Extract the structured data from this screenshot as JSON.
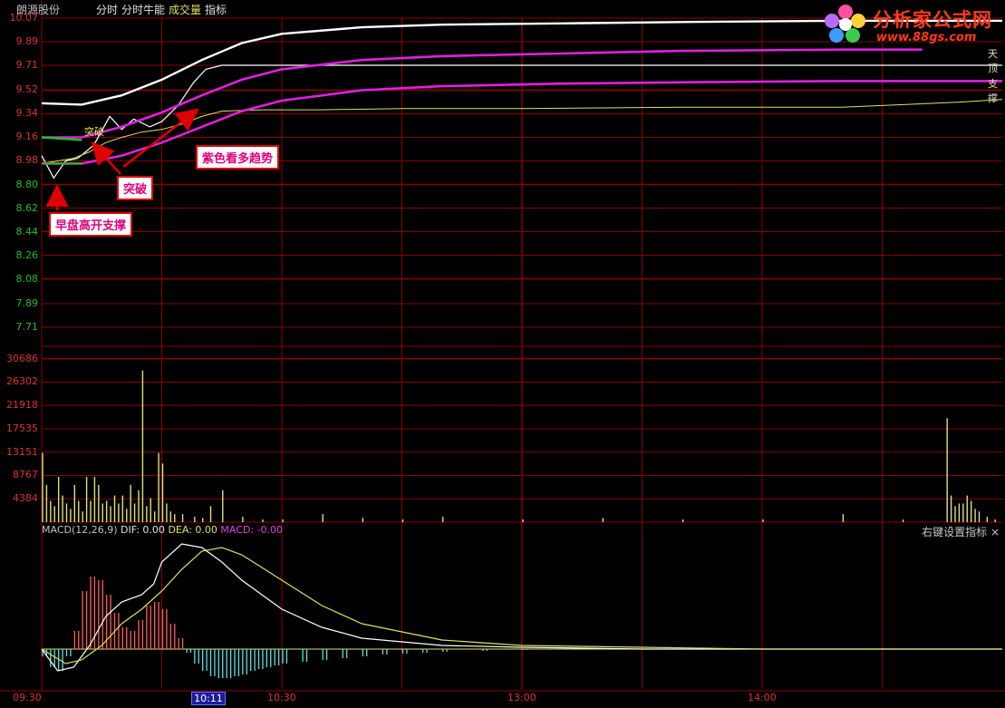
{
  "header": {
    "stock_name": "朗源股份",
    "tabs": [
      "分时",
      "分时牛能",
      "成交量",
      "指标"
    ]
  },
  "logo": {
    "title": "分析家公式网",
    "url": "www.88gs.com"
  },
  "annotations": {
    "support": "早盘高开支撑",
    "breakout": "突破",
    "trend": "紫色看多趋势",
    "inline_breakout": "突破"
  },
  "edge_labels": {
    "upper": "天顶",
    "support": "支撑"
  },
  "macd": {
    "label": "MACD(12,26,9)",
    "dif": "DIF: 0.00",
    "dea": "DEA: 0.00",
    "macd": "MACD: -0.00",
    "right_link": "右键设置指标 ×"
  },
  "colors": {
    "background": "#000000",
    "grid": "#8b0000",
    "axis_text": "#e03030",
    "price_line": "#ffffff",
    "avg_line": "#e0e060",
    "trend_line": "#e020e0",
    "support_line": "#20c020",
    "vol_bar": "#e0e080",
    "macd_pos": "#ff6060",
    "macd_neg": "#60e0e0"
  },
  "chart_data": {
    "type": "line",
    "price_axis": {
      "ticks": [
        "10.07",
        "9.89",
        "9.71",
        "9.52",
        "9.34",
        "9.16",
        "8.98",
        "8.80",
        "8.62",
        "8.44",
        "8.26",
        "8.08",
        "7.89",
        "7.71"
      ],
      "ylim": [
        7.62,
        10.07
      ]
    },
    "time_axis": {
      "ticks": [
        "09:30",
        "10:11",
        "10:30",
        "13:00",
        "14:00"
      ],
      "selected": "10:11"
    },
    "volume_axis": {
      "ticks": [
        "30686",
        "26302",
        "21918",
        "17535",
        "13151",
        "8767",
        "4384"
      ],
      "ylim": [
        0,
        32000
      ]
    },
    "series": [
      {
        "name": "price",
        "x": [
          0,
          3,
          6,
          9,
          13,
          17,
          20,
          23,
          27,
          30,
          34,
          38,
          41,
          45,
          50,
          56,
          65,
          75,
          90,
          110,
          240
        ],
        "y": [
          9.02,
          8.85,
          8.98,
          9.0,
          9.1,
          9.32,
          9.22,
          9.3,
          9.24,
          9.28,
          9.4,
          9.58,
          9.68,
          9.71,
          9.71,
          9.71,
          9.71,
          9.71,
          9.71,
          9.71,
          9.71
        ]
      },
      {
        "name": "avg",
        "x": [
          0,
          4,
          8,
          12,
          16,
          20,
          25,
          30,
          35,
          40,
          45,
          55,
          70,
          90,
          120,
          160,
          200,
          230,
          240
        ],
        "y": [
          8.96,
          8.98,
          9.0,
          9.05,
          9.12,
          9.16,
          9.2,
          9.22,
          9.26,
          9.32,
          9.36,
          9.37,
          9.37,
          9.38,
          9.38,
          9.39,
          9.39,
          9.43,
          9.45
        ]
      },
      {
        "name": "upper_trend",
        "x": [
          0,
          10,
          20,
          30,
          40,
          50,
          60,
          80,
          100,
          130,
          160,
          200,
          240
        ],
        "y": [
          9.42,
          9.41,
          9.48,
          9.6,
          9.75,
          9.88,
          9.95,
          10.0,
          10.02,
          10.03,
          10.04,
          10.05,
          10.05
        ]
      },
      {
        "name": "purple_upper",
        "x": [
          0,
          10,
          20,
          30,
          40,
          50,
          60,
          80,
          100,
          130,
          160,
          200,
          220
        ],
        "y": [
          9.16,
          9.16,
          9.24,
          9.35,
          9.48,
          9.6,
          9.68,
          9.75,
          9.78,
          9.8,
          9.82,
          9.83,
          9.83
        ]
      },
      {
        "name": "purple_lower",
        "x": [
          0,
          10,
          20,
          30,
          40,
          50,
          60,
          80,
          100,
          130,
          160,
          200,
          240
        ],
        "y": [
          8.96,
          8.96,
          9.02,
          9.12,
          9.24,
          9.36,
          9.44,
          9.52,
          9.55,
          9.57,
          9.58,
          9.59,
          9.59
        ]
      },
      {
        "name": "support",
        "x": [
          0,
          10
        ],
        "y": [
          9.16,
          9.14
        ]
      },
      {
        "name": "support_lower",
        "x": [
          0,
          10
        ],
        "y": [
          8.96,
          8.96
        ]
      }
    ],
    "volume": {
      "x": [
        0,
        1,
        2,
        3,
        4,
        5,
        6,
        7,
        8,
        9,
        10,
        11,
        12,
        13,
        14,
        15,
        16,
        17,
        18,
        19,
        20,
        21,
        22,
        23,
        24,
        25,
        26,
        27,
        28,
        29,
        30,
        31,
        32,
        33,
        35,
        38,
        40,
        42,
        45,
        50,
        55,
        60,
        70,
        80,
        90,
        100,
        120,
        140,
        160,
        180,
        200,
        215,
        226,
        227,
        228,
        229,
        230,
        231,
        232,
        233,
        234,
        236,
        238
      ],
      "y": [
        13000,
        7000,
        4000,
        3000,
        8500,
        5000,
        3500,
        2500,
        7000,
        4000,
        2000,
        8500,
        4000,
        8500,
        7000,
        3500,
        4000,
        3000,
        5000,
        3500,
        5000,
        2500,
        7000,
        3500,
        6000,
        28500,
        3000,
        4500,
        2000,
        13000,
        11000,
        3500,
        2000,
        1500,
        1500,
        1000,
        800,
        3000,
        6000,
        1000,
        500,
        500,
        1500,
        800,
        500,
        1000,
        500,
        800,
        500,
        500,
        1500,
        500,
        19500,
        5000,
        3000,
        3500,
        3500,
        5000,
        4000,
        2500,
        2000,
        1000,
        500
      ]
    },
    "macd_series": {
      "dif_x": [
        0,
        4,
        8,
        12,
        16,
        20,
        25,
        28,
        30,
        35,
        40,
        45,
        50,
        60,
        70,
        80,
        100,
        120,
        150,
        180,
        240
      ],
      "dif_y": [
        0,
        -0.12,
        -0.1,
        0.02,
        0.18,
        0.26,
        0.3,
        0.36,
        0.48,
        0.58,
        0.56,
        0.48,
        0.38,
        0.22,
        0.12,
        0.06,
        0.02,
        0.01,
        0.0,
        0.0,
        0.0
      ],
      "dea_x": [
        0,
        6,
        10,
        15,
        20,
        25,
        30,
        35,
        40,
        45,
        50,
        60,
        70,
        80,
        100,
        120,
        150,
        180,
        240
      ],
      "dea_y": [
        0,
        -0.08,
        -0.06,
        0.02,
        0.14,
        0.22,
        0.32,
        0.44,
        0.54,
        0.56,
        0.52,
        0.38,
        0.24,
        0.14,
        0.05,
        0.02,
        0.01,
        0.0,
        0.0
      ],
      "hist_x": [
        0,
        2,
        4,
        6,
        8,
        10,
        12,
        14,
        16,
        18,
        20,
        22,
        24,
        26,
        28,
        30,
        32,
        34,
        36,
        38,
        40,
        42,
        44,
        46,
        48,
        50,
        52,
        54,
        56,
        58,
        60,
        65,
        70,
        75,
        80,
        85,
        90,
        95,
        100,
        110,
        120,
        130,
        140
      ],
      "hist_y": [
        -0.04,
        -0.1,
        -0.12,
        -0.04,
        0.1,
        0.32,
        0.4,
        0.38,
        0.3,
        0.2,
        0.12,
        0.1,
        0.16,
        0.24,
        0.26,
        0.22,
        0.14,
        0.06,
        -0.02,
        -0.08,
        -0.12,
        -0.15,
        -0.16,
        -0.16,
        -0.15,
        -0.14,
        -0.12,
        -0.11,
        -0.1,
        -0.09,
        -0.08,
        -0.07,
        -0.06,
        -0.05,
        -0.04,
        -0.03,
        -0.025,
        -0.02,
        -0.015,
        -0.01,
        -0.005,
        -0.003,
        -0.002
      ],
      "ylim": [
        -0.22,
        0.62
      ]
    },
    "arrow_target_x": 33
  }
}
